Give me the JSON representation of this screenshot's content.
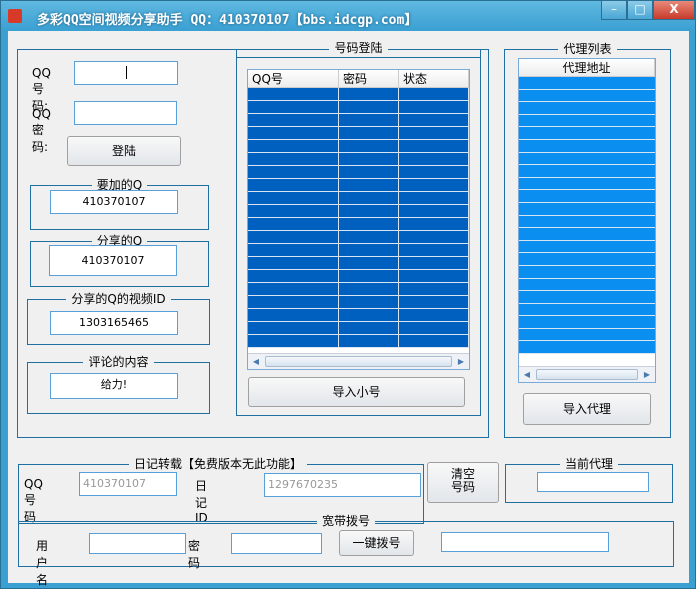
{
  "window": {
    "title": "多彩QQ空间视频分享助手 QQ：410370107【bbs.idcgp.com】",
    "minimize": "–",
    "maximize": "□",
    "close": "X"
  },
  "login": {
    "qq_label": "QQ号码:",
    "qq_value": "",
    "pwd_label": "QQ密码:",
    "pwd_value": "",
    "login_button": "登陆"
  },
  "add_q": {
    "legend": "要加的Q",
    "value": "410370107"
  },
  "share_q": {
    "legend": "分享的Q",
    "value": "410370107"
  },
  "video_id": {
    "legend": "分享的Q的视频ID",
    "value": "1303165465"
  },
  "comment": {
    "legend": "评论的内容",
    "value": "给力!"
  },
  "accounts": {
    "legend": "号码登陆",
    "columns": [
      "QQ号",
      "密码",
      "状态"
    ],
    "row_count": 20,
    "import_button": "导入小号"
  },
  "proxy": {
    "legend": "代理列表",
    "column": "代理地址",
    "row_count": 22,
    "import_button": "导入代理"
  },
  "diary": {
    "legend": "日记转载【免费版本无此功能】",
    "qq_label": "QQ号码",
    "qq_value": "410370107",
    "id_label": "日记ID",
    "id_value": "1297670235"
  },
  "clear_button": [
    "清空",
    "号码"
  ],
  "current_proxy": {
    "legend": "当前代理",
    "value": ""
  },
  "dialup": {
    "legend": "宽带拨号",
    "user_label": "用户名",
    "user_value": "",
    "pwd_label": "密　码",
    "pwd_value": "",
    "dial_button": "一键拨号",
    "status_value": ""
  },
  "colors": {
    "account_rows": "#0060c0",
    "proxy_rows": "#0a8ef0"
  }
}
